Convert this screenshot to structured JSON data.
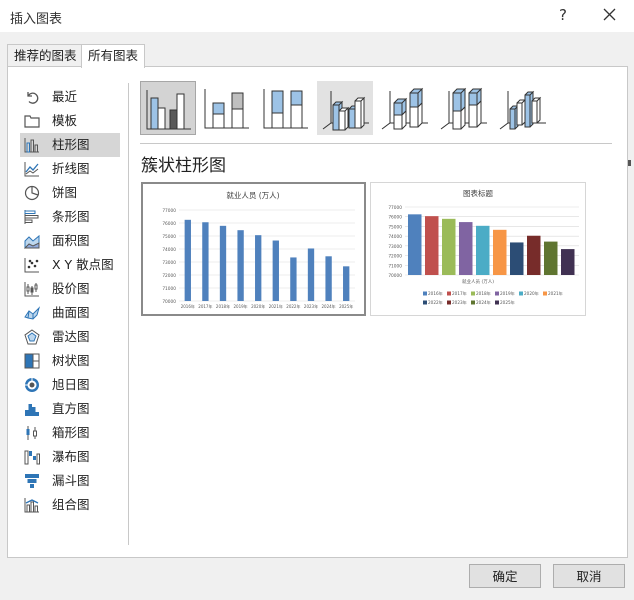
{
  "window": {
    "title": "插入图表",
    "help": "?"
  },
  "tabs": [
    {
      "label": "推荐的图表"
    },
    {
      "label": "所有图表"
    }
  ],
  "categories": [
    {
      "label": "最近",
      "icon": "undo-icon"
    },
    {
      "label": "模板",
      "icon": "folder-icon"
    },
    {
      "label": "柱形图",
      "icon": "column-chart-icon",
      "selected": true
    },
    {
      "label": "折线图",
      "icon": "line-chart-icon"
    },
    {
      "label": "饼图",
      "icon": "pie-chart-icon"
    },
    {
      "label": "条形图",
      "icon": "bar-chart-icon"
    },
    {
      "label": "面积图",
      "icon": "area-chart-icon"
    },
    {
      "label": "X Y 散点图",
      "icon": "scatter-chart-icon"
    },
    {
      "label": "股价图",
      "icon": "stock-chart-icon"
    },
    {
      "label": "曲面图",
      "icon": "surface-chart-icon"
    },
    {
      "label": "雷达图",
      "icon": "radar-chart-icon"
    },
    {
      "label": "树状图",
      "icon": "treemap-icon"
    },
    {
      "label": "旭日图",
      "icon": "sunburst-icon"
    },
    {
      "label": "直方图",
      "icon": "histogram-icon"
    },
    {
      "label": "箱形图",
      "icon": "box-whisker-icon"
    },
    {
      "label": "瀑布图",
      "icon": "waterfall-icon"
    },
    {
      "label": "漏斗图",
      "icon": "funnel-icon"
    },
    {
      "label": "组合图",
      "icon": "combo-chart-icon"
    }
  ],
  "subtypes": [
    {
      "icon": "clustered-column-icon",
      "selected": true
    },
    {
      "icon": "stacked-column-icon"
    },
    {
      "icon": "100-stacked-column-icon"
    },
    {
      "icon": "3d-clustered-column-icon",
      "hover": true
    },
    {
      "icon": "3d-stacked-column-icon"
    },
    {
      "icon": "3d-100-stacked-column-icon"
    },
    {
      "icon": "3d-column-icon"
    }
  ],
  "heading": "簇状柱形图",
  "colors": {
    "series_blue": "#4f81bd",
    "palette": [
      "#4f81bd",
      "#c0504d",
      "#9bbb59",
      "#8064a2",
      "#4bacc6",
      "#f79646",
      "#2c4d75",
      "#772c2a",
      "#5f7530",
      "#403152"
    ]
  },
  "chart_data": [
    {
      "type": "bar",
      "title": "就业人员 (万人)",
      "categories": [
        "2016年",
        "2017年",
        "2018年",
        "2019年",
        "2020年",
        "2021年",
        "2022年",
        "2023年",
        "2024年",
        "2025年"
      ],
      "values": [
        76245,
        76058,
        75782,
        75447,
        75064,
        74652,
        73351,
        74041,
        73439,
        72667
      ],
      "y_ticks": [
        "77000",
        "76000",
        "75000",
        "74000",
        "73000",
        "72000",
        "71000",
        "70000"
      ],
      "ylim": [
        70000,
        77000
      ],
      "grid": true
    },
    {
      "type": "bar",
      "title": "图表标题",
      "xlabel": "就业人员 (万人)",
      "series": [
        {
          "name": "2016年",
          "values": [
            76245
          ]
        },
        {
          "name": "2017年",
          "values": [
            76058
          ]
        },
        {
          "name": "2018年",
          "values": [
            75782
          ]
        },
        {
          "name": "2019年",
          "values": [
            75447
          ]
        },
        {
          "name": "2020年",
          "values": [
            75064
          ]
        },
        {
          "name": "2021年",
          "values": [
            74652
          ]
        },
        {
          "name": "2022年",
          "values": [
            73351
          ]
        },
        {
          "name": "2023年",
          "values": [
            74041
          ]
        },
        {
          "name": "2024年",
          "values": [
            73439
          ]
        },
        {
          "name": "2025年",
          "values": [
            72667
          ]
        }
      ],
      "y_ticks": [
        "77000",
        "76000",
        "75000",
        "74000",
        "73000",
        "72000",
        "71000",
        "70000"
      ],
      "ylim": [
        70000,
        77000
      ],
      "legend": "bottom",
      "grid": true
    }
  ],
  "buttons": {
    "ok": "确定",
    "cancel": "取消"
  }
}
